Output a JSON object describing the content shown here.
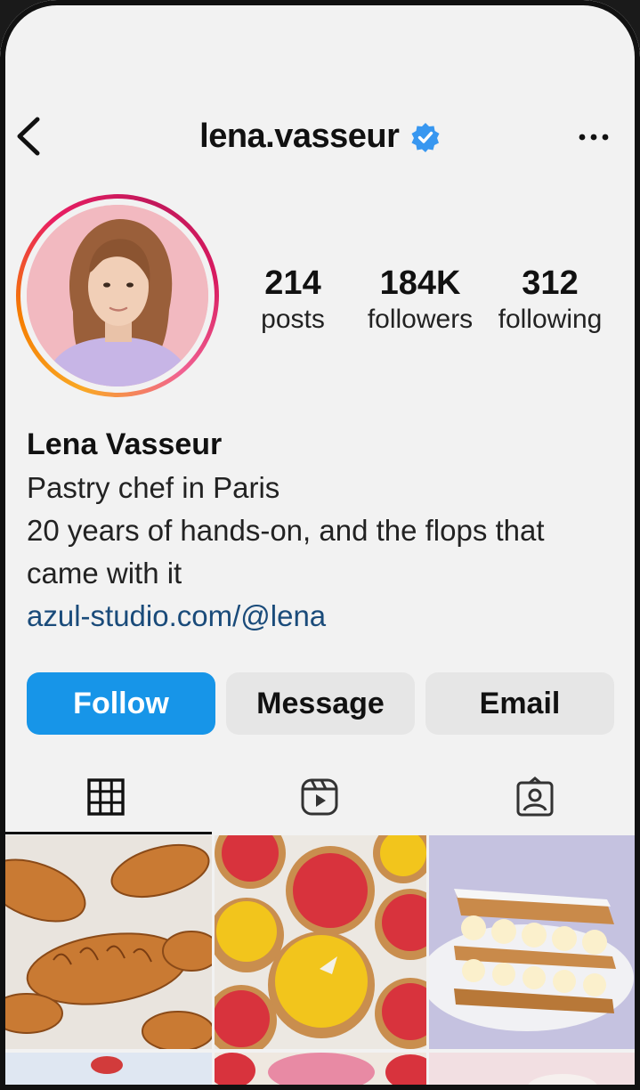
{
  "header": {
    "username": "lena.vasseur",
    "verified": true
  },
  "profile": {
    "stats": [
      {
        "value": "214",
        "label": "posts"
      },
      {
        "value": "184K",
        "label": "followers"
      },
      {
        "value": "312",
        "label": "following"
      }
    ],
    "name": "Lena Vasseur",
    "bio_lines": [
      "Pastry chef in Paris",
      "20 years of hands-on, and the flops that",
      "came with it"
    ],
    "link": "azul-studio.com/@lena"
  },
  "actions": {
    "follow_label": "Follow",
    "message_label": "Message",
    "email_label": "Email"
  },
  "tabs": [
    {
      "icon": "grid-icon",
      "active": true
    },
    {
      "icon": "reels-icon",
      "active": false
    },
    {
      "icon": "tagged-icon",
      "active": false
    }
  ],
  "colors": {
    "follow_button": "#1795e8",
    "verified_badge": "#3897f0",
    "link": "#1a4b7a"
  }
}
